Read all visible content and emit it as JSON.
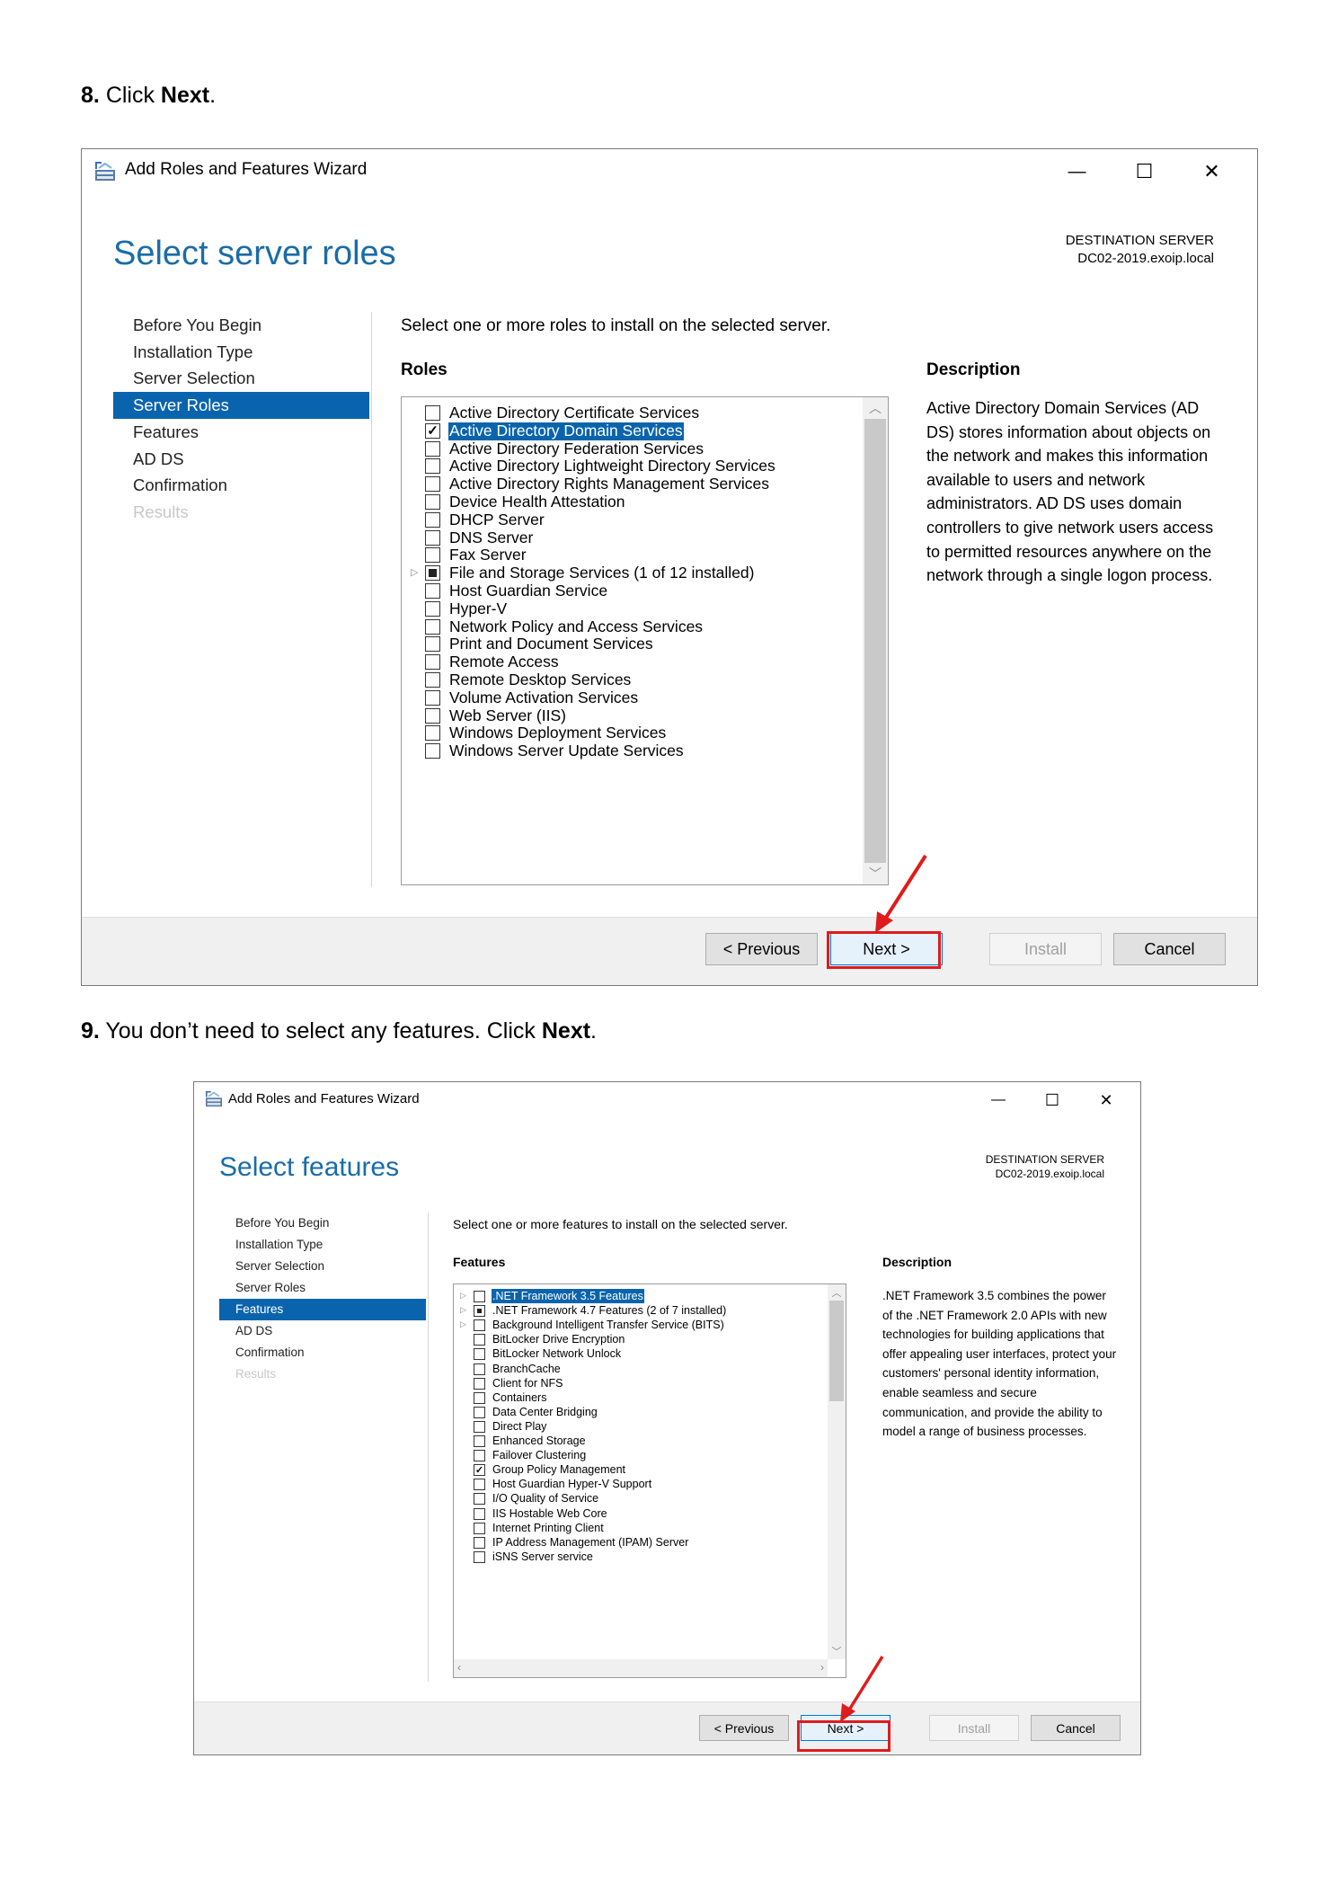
{
  "step8": {
    "num": "8.",
    "text_before": "Click ",
    "bold": "Next",
    "text_after": "."
  },
  "step9": {
    "num": "9.",
    "text_before": "You don’t need to select any features. Click ",
    "bold": "Next",
    "text_after": "."
  },
  "accent_color": "#0a64ad",
  "highlight_color": "#e01b1b",
  "wizard1": {
    "app_title": "Add Roles and Features Wizard",
    "controls": {
      "minimize": "—",
      "maximize": "☐",
      "close": "✕"
    },
    "page_title": "Select server roles",
    "dest_label": "DESTINATION SERVER",
    "dest_server": "DC02-2019.exoip.local",
    "nav": [
      {
        "label": "Before You Begin",
        "state": "normal"
      },
      {
        "label": "Installation Type",
        "state": "normal"
      },
      {
        "label": "Server Selection",
        "state": "normal"
      },
      {
        "label": "Server Roles",
        "state": "active"
      },
      {
        "label": "Features",
        "state": "normal"
      },
      {
        "label": "AD DS",
        "state": "normal"
      },
      {
        "label": "Confirmation",
        "state": "normal"
      },
      {
        "label": "Results",
        "state": "disabled"
      }
    ],
    "instruction": "Select one or more roles to install on the selected server.",
    "list_header": "Roles",
    "items": [
      {
        "label": "Active Directory Certificate Services",
        "state": "unchecked"
      },
      {
        "label": "Active Directory Domain Services",
        "state": "checked",
        "selected": true
      },
      {
        "label": "Active Directory Federation Services",
        "state": "unchecked"
      },
      {
        "label": "Active Directory Lightweight Directory Services",
        "state": "unchecked"
      },
      {
        "label": "Active Directory Rights Management Services",
        "state": "unchecked"
      },
      {
        "label": "Device Health Attestation",
        "state": "unchecked"
      },
      {
        "label": "DHCP Server",
        "state": "unchecked"
      },
      {
        "label": "DNS Server",
        "state": "unchecked"
      },
      {
        "label": "Fax Server",
        "state": "unchecked"
      },
      {
        "label": "File and Storage Services (1 of 12 installed)",
        "state": "partial",
        "expandable": true
      },
      {
        "label": "Host Guardian Service",
        "state": "unchecked"
      },
      {
        "label": "Hyper-V",
        "state": "unchecked"
      },
      {
        "label": "Network Policy and Access Services",
        "state": "unchecked"
      },
      {
        "label": "Print and Document Services",
        "state": "unchecked"
      },
      {
        "label": "Remote Access",
        "state": "unchecked"
      },
      {
        "label": "Remote Desktop Services",
        "state": "unchecked"
      },
      {
        "label": "Volume Activation Services",
        "state": "unchecked"
      },
      {
        "label": "Web Server (IIS)",
        "state": "unchecked"
      },
      {
        "label": "Windows Deployment Services",
        "state": "unchecked"
      },
      {
        "label": "Windows Server Update Services",
        "state": "unchecked"
      }
    ],
    "desc_header": "Description",
    "description": "Active Directory Domain Services (AD DS) stores information about objects on the network and makes this information available to users and network administrators. AD DS uses domain controllers to give network users access to permitted resources anywhere on the network through a single logon process.",
    "buttons": {
      "previous": "< Previous",
      "next": "Next >",
      "install": "Install",
      "cancel": "Cancel"
    }
  },
  "wizard2": {
    "app_title": "Add Roles and Features Wizard",
    "controls": {
      "minimize": "—",
      "maximize": "☐",
      "close": "✕"
    },
    "page_title": "Select features",
    "dest_label": "DESTINATION SERVER",
    "dest_server": "DC02-2019.exoip.local",
    "nav": [
      {
        "label": "Before You Begin",
        "state": "normal"
      },
      {
        "label": "Installation Type",
        "state": "normal"
      },
      {
        "label": "Server Selection",
        "state": "normal"
      },
      {
        "label": "Server Roles",
        "state": "normal"
      },
      {
        "label": "Features",
        "state": "active"
      },
      {
        "label": "AD DS",
        "state": "normal"
      },
      {
        "label": "Confirmation",
        "state": "normal"
      },
      {
        "label": "Results",
        "state": "disabled"
      }
    ],
    "instruction": "Select one or more features to install on the selected server.",
    "list_header": "Features",
    "items": [
      {
        "label": ".NET Framework 3.5 Features",
        "state": "unchecked",
        "expandable": true,
        "selected": true
      },
      {
        "label": ".NET Framework 4.7 Features (2 of 7 installed)",
        "state": "partial",
        "expandable": true
      },
      {
        "label": "Background Intelligent Transfer Service (BITS)",
        "state": "unchecked",
        "expandable": true
      },
      {
        "label": "BitLocker Drive Encryption",
        "state": "unchecked"
      },
      {
        "label": "BitLocker Network Unlock",
        "state": "unchecked"
      },
      {
        "label": "BranchCache",
        "state": "unchecked"
      },
      {
        "label": "Client for NFS",
        "state": "unchecked"
      },
      {
        "label": "Containers",
        "state": "unchecked"
      },
      {
        "label": "Data Center Bridging",
        "state": "unchecked"
      },
      {
        "label": "Direct Play",
        "state": "unchecked"
      },
      {
        "label": "Enhanced Storage",
        "state": "unchecked"
      },
      {
        "label": "Failover Clustering",
        "state": "unchecked"
      },
      {
        "label": "Group Policy Management",
        "state": "checked"
      },
      {
        "label": "Host Guardian Hyper-V Support",
        "state": "unchecked"
      },
      {
        "label": "I/O Quality of Service",
        "state": "unchecked"
      },
      {
        "label": "IIS Hostable Web Core",
        "state": "unchecked"
      },
      {
        "label": "Internet Printing Client",
        "state": "unchecked"
      },
      {
        "label": "IP Address Management (IPAM) Server",
        "state": "unchecked"
      },
      {
        "label": "iSNS Server service",
        "state": "unchecked"
      }
    ],
    "desc_header": "Description",
    "description": ".NET Framework 3.5 combines the power of the .NET Framework 2.0 APIs with new technologies for building applications that offer appealing user interfaces, protect your customers' personal identity information, enable seamless and secure communication, and provide the ability to model a range of business processes.",
    "buttons": {
      "previous": "< Previous",
      "next": "Next >",
      "install": "Install",
      "cancel": "Cancel"
    }
  }
}
